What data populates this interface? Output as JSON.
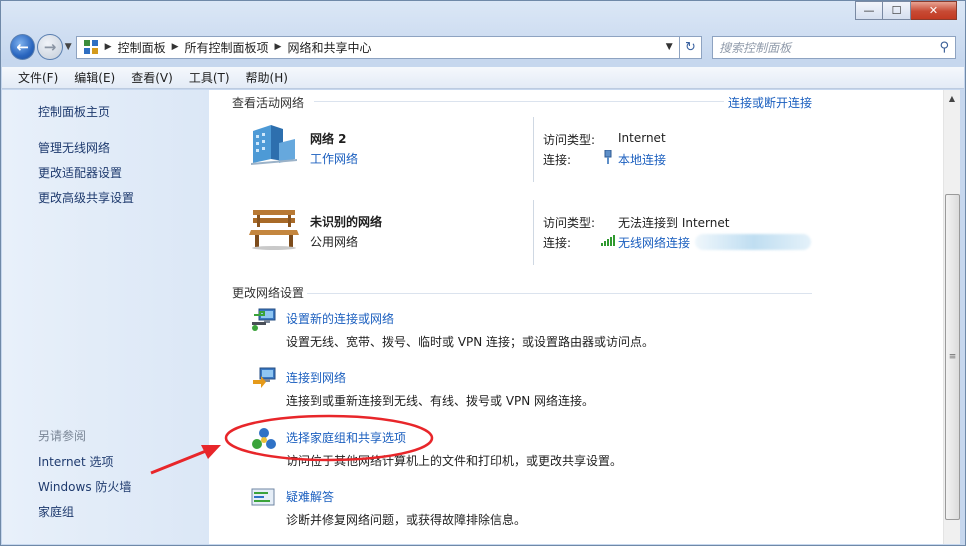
{
  "window": {
    "caption": {
      "minimize": "—",
      "maximize": "☐",
      "close": "✕"
    }
  },
  "address_bar": {
    "breadcrumbs": [
      "控制面板",
      "所有控制面板项",
      "网络和共享中心"
    ],
    "search_placeholder": "搜索控制面板"
  },
  "menu": [
    "文件(F)",
    "编辑(E)",
    "查看(V)",
    "工具(T)",
    "帮助(H)"
  ],
  "sidebar": {
    "home": "控制面板主页",
    "links": [
      "管理无线网络",
      "更改适配器设置",
      "更改高级共享设置"
    ],
    "see_also_heading": "另请参阅",
    "see_also": [
      "Internet 选项",
      "Windows 防火墙",
      "家庭组"
    ]
  },
  "active_networks": {
    "heading": "查看活动网络",
    "connect_link": "连接或断开连接",
    "networks": [
      {
        "name": "网络  2",
        "type": "工作网络",
        "type_is_link": true,
        "access_label": "访问类型:",
        "access": "Internet",
        "conn_label": "连接:",
        "connection": "本地连接"
      },
      {
        "name": "未识别的网络",
        "type": "公用网络",
        "type_is_link": false,
        "access_label": "访问类型:",
        "access": "无法连接到 Internet",
        "conn_label": "连接:",
        "connection": "无线网络连接"
      }
    ]
  },
  "change_settings": {
    "heading": "更改网络设置",
    "items": [
      {
        "title": "设置新的连接或网络",
        "desc": "设置无线、宽带、拨号、临时或 VPN 连接；或设置路由器或访问点。",
        "icon": "network-setup-icon"
      },
      {
        "title": "连接到网络",
        "desc": "连接到或重新连接到无线、有线、拨号或 VPN 网络连接。",
        "icon": "connect-network-icon"
      },
      {
        "title": "选择家庭组和共享选项",
        "desc": "访问位于其他网络计算机上的文件和打印机，或更改共享设置。",
        "icon": "homegroup-icon"
      },
      {
        "title": "疑难解答",
        "desc": "诊断并修复网络问题，或获得故障排除信息。",
        "icon": "troubleshoot-icon"
      }
    ]
  },
  "colors": {
    "link": "#1b5fbf",
    "annotation": "#e8262a"
  }
}
